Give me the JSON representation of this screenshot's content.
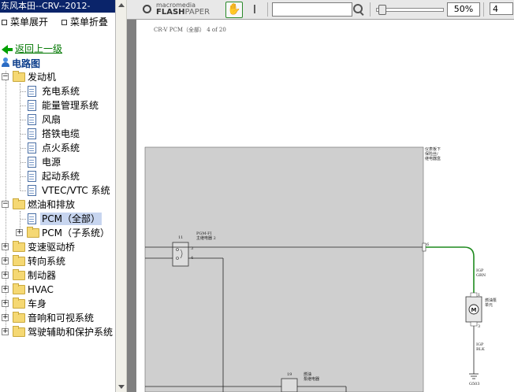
{
  "window": {
    "title": "东风本田--CRV--2012-"
  },
  "menu": {
    "expand_label": "菜单展开",
    "collapse_label": "菜单折叠"
  },
  "back_link": {
    "label": "返回上一级"
  },
  "tree": {
    "root": "电路图",
    "engine": {
      "label": "发动机",
      "children": [
        "充电系统",
        "能量管理系统",
        "风扇",
        "搭铁电缆",
        "点火系统",
        "电源",
        "起动系统",
        "VTEC/VTC 系统"
      ]
    },
    "fuel": {
      "label": "燃油和排放",
      "children": [
        "PCM（全部）",
        "PCM（子系统）"
      ]
    },
    "others": [
      "变速驱动桥",
      "转向系统",
      "制动器",
      "HVAC",
      "车身",
      "音响和可视系统",
      "驾驶辅助和保护系统"
    ]
  },
  "toolbar": {
    "logo_top": "macromedia",
    "logo_main": "FLASH",
    "logo_sub": "PAPER",
    "search_value": "",
    "zoom": "50%",
    "page": "4"
  },
  "document": {
    "header": "CR-V PCM（全部） 4 of 20",
    "labels": {
      "fuse_box": "仪表板下\n保险丝/\n继电器盒",
      "relay_num": "11",
      "relay_name": "PGM-FI\n主继电器 2",
      "pin_top": "3",
      "pin_bottom": "4",
      "connector_pin": "6",
      "wire_color_top": "IGP\nGRN",
      "fuel_pump_label": "燃油泵\n单元",
      "wire_color_bottom": "IGP\nBLK",
      "ground": "G503",
      "relay2_num": "19",
      "relay2_name": "燃油\n泵继电器",
      "pump_pin_top": "1",
      "pump_pin_bottom": "3"
    }
  },
  "colors": {
    "wire_green": "#1e8a1e",
    "title_bar": "#0a246a",
    "selection": "#c7d5ef"
  }
}
